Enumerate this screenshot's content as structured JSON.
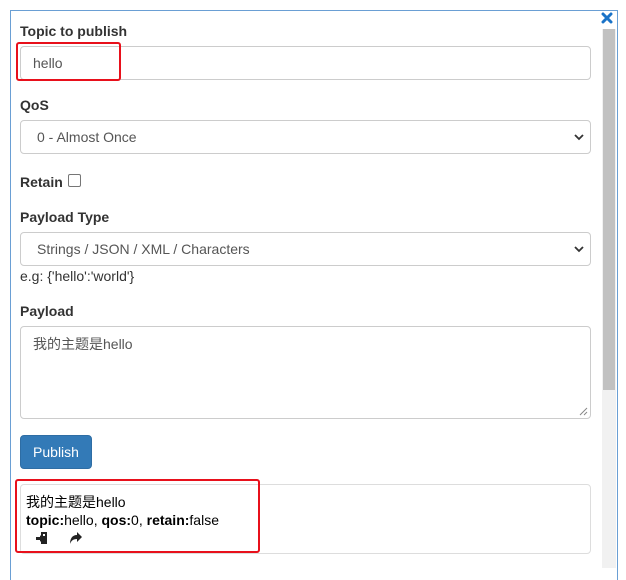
{
  "form": {
    "topic_label": "Topic to publish",
    "topic_value": "hello",
    "qos_label": "QoS",
    "qos_value": "0 - Almost Once",
    "retain_label": "Retain",
    "retain_checked": false,
    "payload_type_label": "Payload Type",
    "payload_type_value": "Strings / JSON / XML / Characters",
    "payload_type_hint": "e.g: {'hello':'world'}",
    "payload_label": "Payload",
    "payload_value": "我的主题是hello",
    "publish_label": "Publish"
  },
  "message": {
    "payload": "我的主题是hello",
    "topic_key": "topic:",
    "topic_value": "hello",
    "qos_key": "qos:",
    "qos_value": "0",
    "retain_key": "retain:",
    "retain_value": "false",
    "separator": ", "
  },
  "icons": {
    "close": "close-icon",
    "chevron": "chevron-down-icon",
    "republish": "republish-icon",
    "forward": "share-arrow-icon"
  },
  "colors": {
    "primary": "#337ab7",
    "highlight": "#e8101b",
    "close": "#1a73c8",
    "panel_border": "#6a9fd4"
  }
}
